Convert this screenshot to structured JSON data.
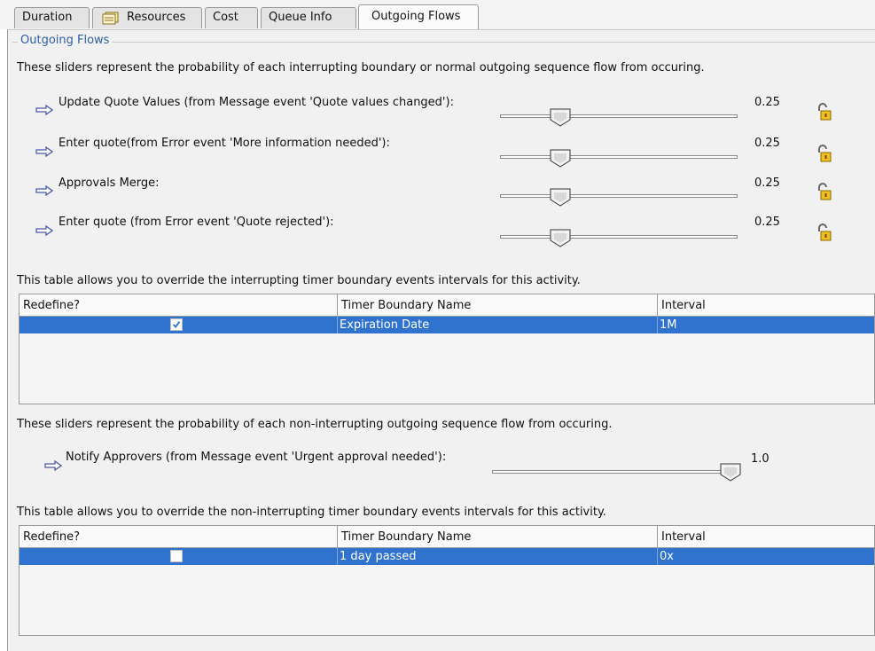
{
  "tabs": [
    {
      "label": "Duration"
    },
    {
      "label": "Resources"
    },
    {
      "label": "Cost"
    },
    {
      "label": "Queue Info"
    },
    {
      "label": "Outgoing Flows",
      "active": true
    }
  ],
  "group_title": "Outgoing Flows",
  "interrupting": {
    "description": "These sliders represent the probability of each interrupting boundary or normal outgoing sequence flow from occuring.",
    "flows": [
      {
        "label": "Update Quote Values (from Message event 'Quote values changed'):",
        "value_text": "0.25",
        "probability": 0.25,
        "icon": "unlocked-padlock-icon"
      },
      {
        "label": "Enter quote(from Error event 'More information needed'):",
        "value_text": "0.25",
        "probability": 0.25,
        "icon": "unlocked-padlock-icon"
      },
      {
        "label": "Approvals Merge:",
        "value_text": "0.25",
        "probability": 0.25,
        "icon": "unlocked-padlock-icon"
      },
      {
        "label": "Enter quote (from Error event 'Quote rejected'):",
        "value_text": "0.25",
        "probability": 0.25,
        "icon": "unlocked-padlock-icon"
      }
    ]
  },
  "interrupting_table": {
    "description": "This table allows you to override the interrupting timer boundary events intervals for this activity.",
    "headers": [
      "Redefine?",
      "Timer Boundary Name",
      "Interval"
    ],
    "rows": [
      {
        "redefine": true,
        "name": "Expiration Date",
        "interval": "1M"
      }
    ]
  },
  "non_interrupting": {
    "description": "These sliders represent the probability of each non-interrupting outgoing sequence flow from occuring.",
    "flows": [
      {
        "label": "Notify Approvers (from Message event 'Urgent approval needed'):",
        "value_text": "1.0",
        "probability": 1.0
      }
    ]
  },
  "non_interrupting_table": {
    "description": "This table allows you to override the non-interrupting timer boundary events intervals for this activity.",
    "headers": [
      "Redefine?",
      "Timer Boundary Name",
      "Interval"
    ],
    "rows": [
      {
        "redefine": false,
        "name": "1 day passed",
        "interval": "0x"
      }
    ]
  },
  "colors": {
    "selection": "#2f73cf",
    "group_title": "#2f5ea4",
    "arrow": "#4a5aa8",
    "lock": "#e0b000"
  }
}
